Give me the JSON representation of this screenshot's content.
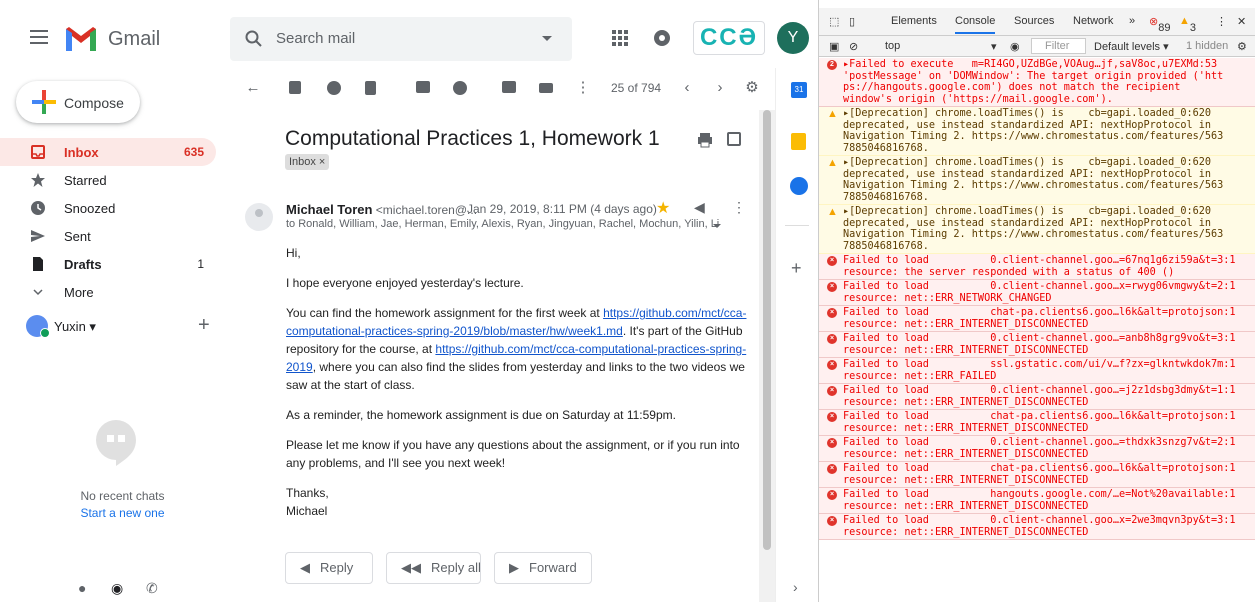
{
  "app": {
    "name": "Gmail"
  },
  "search": {
    "placeholder": "Search mail"
  },
  "header": {
    "avatar_letter": "Y",
    "org_logo": "CCƏ"
  },
  "compose": {
    "label": "Compose"
  },
  "nav": [
    {
      "label": "Inbox",
      "count": "635",
      "icon": "inbox-icon"
    },
    {
      "label": "Starred",
      "count": "",
      "icon": "star-icon"
    },
    {
      "label": "Snoozed",
      "count": "",
      "icon": "clock-icon"
    },
    {
      "label": "Sent",
      "count": "",
      "icon": "send-icon"
    },
    {
      "label": "Drafts",
      "count": "1",
      "icon": "file-icon"
    },
    {
      "label": "More",
      "count": "",
      "icon": "chevron-down-icon"
    }
  ],
  "hangouts": {
    "user": "Yuxin ▾",
    "no_chats": "No recent chats",
    "start": "Start a new one"
  },
  "toolbar": {
    "pager": "25 of 794"
  },
  "email": {
    "subject": "Computational Practices 1, Homework 1",
    "label": "Inbox",
    "sender_name": "Michael Toren",
    "sender_email": "<michael.toren@...",
    "date": "Jan 29, 2019, 8:11 PM (4 days ago)",
    "to": "to Ronald, William, Jae, Herman, Emily, Alexis, Ryan, Jingyuan, Rachel, Mochun, Yilin, Lir",
    "greeting": "Hi,",
    "p1": "I hope everyone enjoyed yesterday's lecture.",
    "p2a": "You can find the homework assignment for the first week at ",
    "link1": "https://github.com/mct/cca-computational-practices-spring-2019/blob/master/hw/week1.md",
    "p2b": ". It's part of the GitHub repository for the course, at ",
    "link2": "https://github.com/mct/cca-computational-practices-spring-2019",
    "p2c": ", where you can also find the slides from yesterday and links to the two videos we saw at the start of class.",
    "p3": "As a reminder, the homework assignment is due on Saturday at 11:59pm.",
    "p4": "Please let me know if you have any questions about the assignment, or if you run into any problems, and I'll see you next week!",
    "closing": "Thanks,",
    "signature": "Michael"
  },
  "actions": {
    "reply": "Reply",
    "reply_all": "Reply all",
    "forward": "Forward"
  },
  "devtools": {
    "tabs": [
      "Elements",
      "Console",
      "Sources",
      "Network",
      "»"
    ],
    "error_count": "89",
    "warn_count": "3",
    "context": "top",
    "filter": "Filter",
    "levels": "Default levels ▾",
    "hidden": "1 hidden",
    "logs": [
      {
        "type": "err",
        "badge": "2",
        "text": "▸Failed to execute   m=RI4GO,UZdBGe,VOAug…jf,saV8oc,u7EXMd:53\n'postMessage' on 'DOMWindow': The target origin provided ('htt\nps://hangouts.google.com') does not match the recipient\nwindow's origin ('https://mail.google.com')."
      },
      {
        "type": "warn",
        "text": "▸[Deprecation] chrome.loadTimes() is    cb=gapi.loaded_0:620\ndeprecated, use instead standardized API: nextHopProtocol in\nNavigation Timing 2. https://www.chromestatus.com/features/563\n7885046816768."
      },
      {
        "type": "warn",
        "text": "▸[Deprecation] chrome.loadTimes() is    cb=gapi.loaded_0:620\ndeprecated, use instead standardized API: nextHopProtocol in\nNavigation Timing 2. https://www.chromestatus.com/features/563\n7885046816768."
      },
      {
        "type": "warn",
        "text": "▸[Deprecation] chrome.loadTimes() is    cb=gapi.loaded_0:620\ndeprecated, use instead standardized API: nextHopProtocol in\nNavigation Timing 2. https://www.chromestatus.com/features/563\n7885046816768."
      },
      {
        "type": "err",
        "text": "Failed to load          0.client-channel.goo…=67nq1g6zi59a&t=3:1\nresource: the server responded with a status of 400 ()"
      },
      {
        "type": "err",
        "text": "Failed to load          0.client-channel.goo…x=rwyg06vmgwy&t=2:1\nresource: net::ERR_NETWORK_CHANGED"
      },
      {
        "type": "err",
        "text": "Failed to load          chat-pa.clients6.goo…l6k&alt=protojson:1\nresource: net::ERR_INTERNET_DISCONNECTED"
      },
      {
        "type": "err",
        "text": "Failed to load          0.client-channel.goo…=anb8h8grg9vo&t=3:1\nresource: net::ERR_INTERNET_DISCONNECTED"
      },
      {
        "type": "err",
        "text": "Failed to load          ssl.gstatic.com/ui/v…f?zx=glkntwkdok7m:1\nresource: net::ERR_FAILED"
      },
      {
        "type": "err",
        "text": "Failed to load          0.client-channel.goo…=j2z1dsbg3dmy&t=1:1\nresource: net::ERR_INTERNET_DISCONNECTED"
      },
      {
        "type": "err",
        "text": "Failed to load          chat-pa.clients6.goo…l6k&alt=protojson:1\nresource: net::ERR_INTERNET_DISCONNECTED"
      },
      {
        "type": "err",
        "text": "Failed to load          0.client-channel.goo…=thdxk3snzg7v&t=2:1\nresource: net::ERR_INTERNET_DISCONNECTED"
      },
      {
        "type": "err",
        "text": "Failed to load          chat-pa.clients6.goo…l6k&alt=protojson:1\nresource: net::ERR_INTERNET_DISCONNECTED"
      },
      {
        "type": "err",
        "text": "Failed to load          hangouts.google.com/…e=Not%20available:1\nresource: net::ERR_INTERNET_DISCONNECTED"
      },
      {
        "type": "err",
        "text": "Failed to load          0.client-channel.goo…x=2we3mqvn3py&t=3:1\nresource: net::ERR_INTERNET_DISCONNECTED"
      }
    ]
  }
}
